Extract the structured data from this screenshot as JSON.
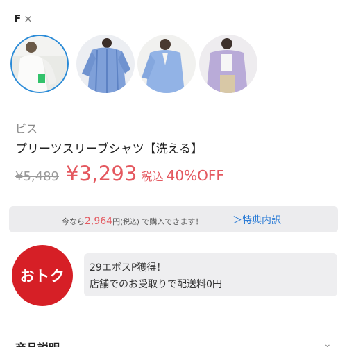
{
  "size_filter": {
    "label": "F",
    "remove_icon": "×"
  },
  "thumbnails": [
    {
      "icon": "shirt-white",
      "selected": true,
      "color": "#f2f2ee"
    },
    {
      "icon": "shirt-blue-stripe",
      "selected": false,
      "color": "#7d9ed8"
    },
    {
      "icon": "shirt-blue",
      "selected": false,
      "color": "#8fb2e6"
    },
    {
      "icon": "shirt-lavender",
      "selected": false,
      "color": "#b7a9d6"
    }
  ],
  "product": {
    "brand": "ビス",
    "name": "プリーツスリーブシャツ【洗える】"
  },
  "price": {
    "original": "¥5,489",
    "sale": "¥3,293",
    "tax_label": "税込",
    "discount": "40%OFF"
  },
  "deal": {
    "prefix": "今なら",
    "amount": "2,964",
    "yen": "円",
    "tax": "(税込)",
    "suffix": "で購入できます！",
    "link": "＞特典内訳"
  },
  "otoku": {
    "badge": "おトク",
    "lines": [
      "29エポスP獲得！",
      "店舗でのお受取りで配送料0円"
    ]
  },
  "section": {
    "title": "商品説明"
  },
  "colors": {
    "accent": "#e4585f",
    "link": "#2a7bd6",
    "badge": "#d61f26",
    "selected_border": "#2a8bd8"
  }
}
